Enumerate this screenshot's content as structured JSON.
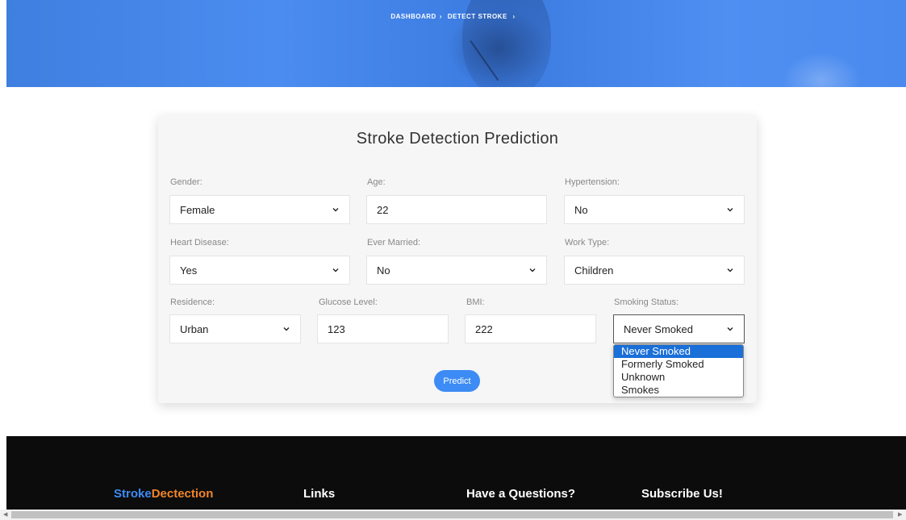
{
  "breadcrumb": {
    "item1": "DASHBOARD",
    "sep1": "›",
    "item2": "DETECT STROKE",
    "sep2": "›"
  },
  "form": {
    "title": "Stroke Detection Prediction",
    "gender": {
      "label": "Gender:",
      "value": "Female"
    },
    "age": {
      "label": "Age:",
      "value": "22"
    },
    "hypertension": {
      "label": "Hypertension:",
      "value": "No"
    },
    "heart_disease": {
      "label": "Heart Disease:",
      "value": "Yes"
    },
    "ever_married": {
      "label": "Ever Married:",
      "value": "No"
    },
    "work_type": {
      "label": "Work Type:",
      "value": "Children"
    },
    "residence": {
      "label": "Residence:",
      "value": "Urban"
    },
    "glucose": {
      "label": "Glucose Level:",
      "value": "123"
    },
    "bmi": {
      "label": "BMI:",
      "value": "222"
    },
    "smoking": {
      "label": "Smoking Status:",
      "value": "Never Smoked",
      "options": [
        "Never Smoked",
        "Formerly Smoked",
        "Unknown",
        "Smokes"
      ]
    },
    "predict_label": "Predict"
  },
  "footer": {
    "brand_part1": "Stroke",
    "brand_part2": "Dectection",
    "links_heading": "Links",
    "questions_heading": "Have a Questions?",
    "subscribe_heading": "Subscribe Us!"
  },
  "colors": {
    "accent": "#3d8bf5",
    "brand_orange": "#f0852a",
    "footer_bg": "#0c0c0c"
  }
}
